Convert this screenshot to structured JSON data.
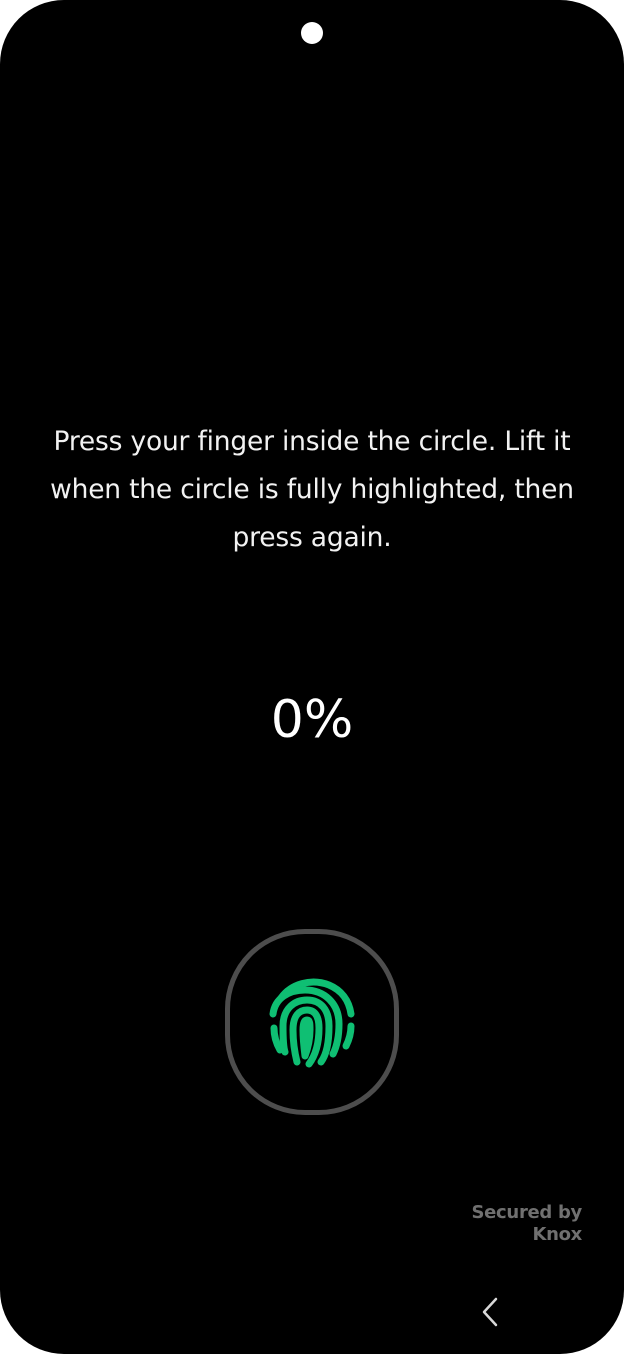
{
  "instructions": {
    "text": "Press your finger inside the circle. Lift it when the circle is fully highlighted, then press again."
  },
  "progress": {
    "text": "0%",
    "value": 0
  },
  "sensor": {
    "icon": "fingerprint-icon",
    "icon_color": "#0fbf73",
    "ring_color": "#4d4d4d"
  },
  "knox": {
    "line1": "Secured by",
    "line2": "Knox"
  },
  "navigation": {
    "back_icon": "chevron-left-icon"
  }
}
